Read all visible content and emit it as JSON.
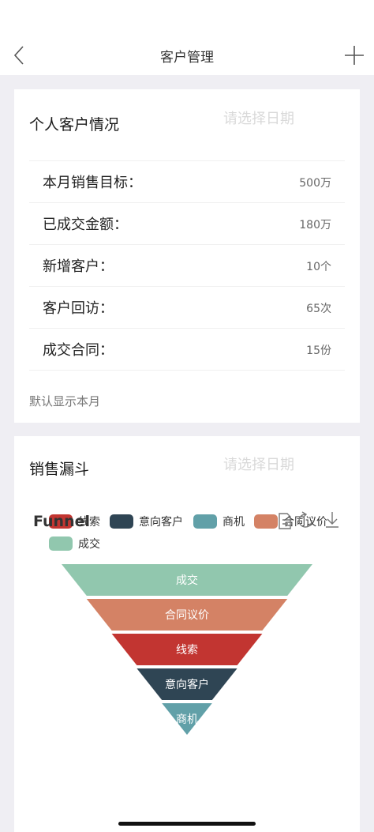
{
  "nav": {
    "title": "客户管理",
    "back_icon": "chevron-left-icon",
    "add_icon": "plus-icon"
  },
  "personal": {
    "title": "个人客户情况",
    "date_placeholder": "请选择日期",
    "stats": [
      {
        "label": "本月销售目标：",
        "value": "500万"
      },
      {
        "label": "已成交金额：",
        "value": "180万"
      },
      {
        "label": "新增客户：",
        "value": "10个"
      },
      {
        "label": "客户回访：",
        "value": "65次"
      },
      {
        "label": "成交合同：",
        "value": "15份"
      }
    ],
    "note": "默认显示本月"
  },
  "funnel_card": {
    "title": "销售漏斗",
    "date_placeholder": "请选择日期",
    "chart_title": "Funnel",
    "toolbox_icons": [
      "data-view-icon",
      "restore-icon",
      "download-icon"
    ]
  },
  "chart_data": {
    "type": "funnel",
    "title": "Funnel",
    "legend": [
      "线索",
      "意向客户",
      "商机",
      "合同议价",
      "成交"
    ],
    "colors": {
      "线索": "#c23531",
      "意向客户": "#2f4554",
      "商机": "#61a0a8",
      "合同议价": "#d48265",
      "成交": "#91c7ae"
    },
    "stages_top_to_bottom": [
      "成交",
      "合同议价",
      "线索",
      "意向客户",
      "商机"
    ],
    "relative_widths": [
      1.0,
      0.8,
      0.6,
      0.4,
      0.2
    ],
    "sort": "ascending",
    "legend_position": "top"
  }
}
